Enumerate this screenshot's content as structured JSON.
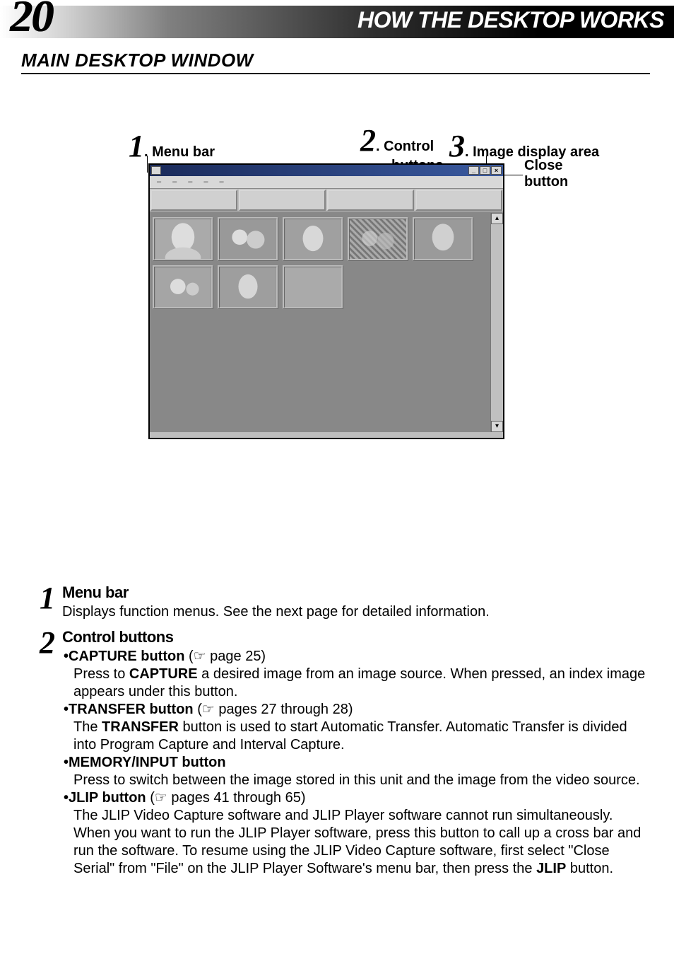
{
  "header": {
    "page_number": "20",
    "title": "HOW THE DESKTOP WORKS",
    "section": "MAIN DESKTOP WINDOW"
  },
  "callouts": {
    "c1": {
      "num": "1",
      "label": "Menu bar"
    },
    "c2": {
      "num": "2",
      "label": "Control",
      "label2": "buttons"
    },
    "c3": {
      "num": "3",
      "label": "Image display area"
    },
    "close": {
      "line1": "Close",
      "line2": "button"
    }
  },
  "window": {
    "win_min": "_",
    "win_max": "□",
    "win_close": "×",
    "menu_items": [
      "–",
      "–",
      "–",
      "–",
      "–"
    ],
    "scroll_up": "▴",
    "scroll_down": "▾"
  },
  "items": {
    "i1": {
      "num": "1",
      "heading": "Menu bar",
      "p1": "Displays function menus. See the next page for detailed information."
    },
    "i2": {
      "num": "2",
      "heading": "Control buttons",
      "capture": {
        "bullet": "•",
        "label": "CAPTURE button",
        "ref": " (☞ page 25)",
        "body1": "Press to ",
        "bold": "CAPTURE",
        "body2": " a desired image from an image source.  When pressed, an index image appears under this button."
      },
      "transfer": {
        "bullet": "•",
        "label": "TRANSFER button",
        "ref": " (☞ pages 27 through 28)",
        "body1": "The ",
        "bold": "TRANSFER",
        "body2": " button is used to start Automatic Transfer.  Automatic Transfer is divided into Program Capture and Interval Capture."
      },
      "memory": {
        "bullet": "•",
        "label": "MEMORY/INPUT button",
        "body": "Press to switch between the image stored in this unit and the image from the video source."
      },
      "jlip": {
        "bullet": "•",
        "label": "JLIP button",
        "ref": " (☞ pages 41 through 65)",
        "body1": "The JLIP Video Capture software and JLIP Player software cannot run simultaneously. When you want to run the JLIP Player software, press this button to call up a cross bar and run the software. To resume using the JLIP Video Capture software, first select \"Close Serial\" from \"File\" on the JLIP Player Software's menu bar, then press the ",
        "bold": "JLIP",
        "body2": " button."
      }
    }
  }
}
